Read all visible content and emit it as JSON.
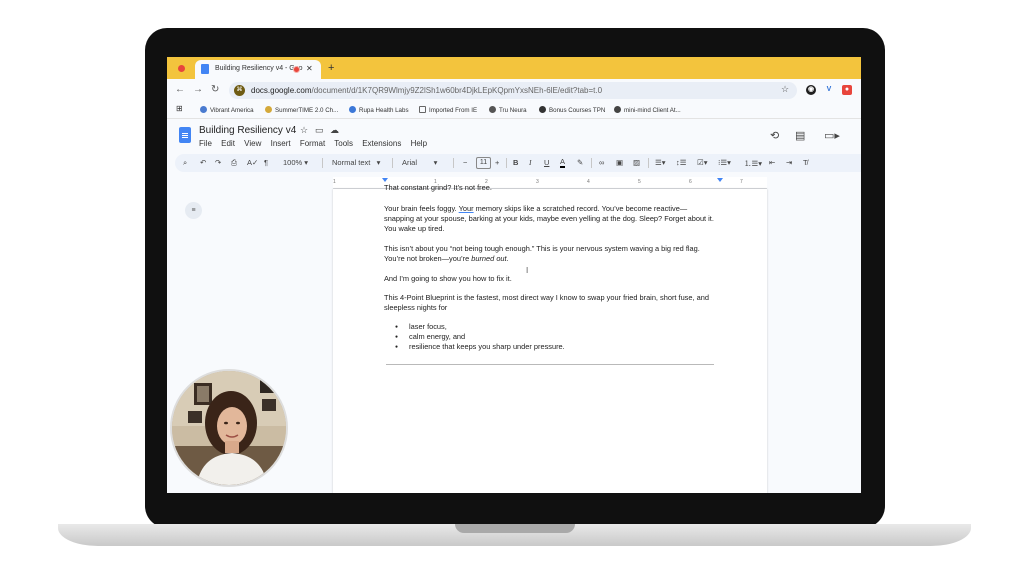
{
  "browser": {
    "tab_title": "Building Resiliency v4 - Goo",
    "tab_close": "✕",
    "new_tab": "+",
    "url_host": "docs.google.com",
    "url_path": "/document/d/1K7QR9Wlmjy9Z2lSh1w60br4DjkLEpKQpmYxsNEh-6lE/edit?tab=t.0",
    "extensions": [
      "V"
    ],
    "bookmarks": [
      {
        "label": "Vibrant America",
        "color": "#4a7bd0"
      },
      {
        "label": "SummerTIME 2.0 Ch...",
        "color": "#d4a93a"
      },
      {
        "label": "Rupa Health Labs",
        "color": "#3c78d8"
      },
      {
        "label": "Imported From IE",
        "color": "#888888"
      },
      {
        "label": "Tru Neura",
        "color": "#555555"
      },
      {
        "label": "Bonus Courses TPN",
        "color": "#333333"
      },
      {
        "label": "mini-mind Client At...",
        "color": "#444444"
      }
    ]
  },
  "docs": {
    "title": "Building Resiliency v4",
    "menu": [
      "File",
      "Edit",
      "View",
      "Insert",
      "Format",
      "Tools",
      "Extensions",
      "Help"
    ],
    "toolbar": {
      "zoom": "100%",
      "style": "Normal text",
      "font": "Arial",
      "font_size": "11",
      "minus": "−",
      "plus": "+"
    },
    "ruler_numbers": [
      "1",
      "1",
      "2",
      "3",
      "4",
      "5",
      "6",
      "7"
    ]
  },
  "document": {
    "p0": "That constant grind? It’s not free.",
    "p1_a": "Your brain feels foggy. ",
    "p1_u": "Your",
    "p1_b": " memory skips like a scratched record. You’ve become reactive—snapping at your spouse, barking at your kids, maybe even yelling at the dog. Sleep? Forget about it. You wake up tired.",
    "p2_a": "This isn’t about you “not being tough enough.” This is your nervous system waving a big red flag. You’re not broken—you’re ",
    "p2_i": "burned out",
    "p2_b": ".",
    "p3": "And I’m going to show you how to fix it.",
    "p4": "This 4-Point Blueprint is the fastest, most direct way I know to swap your fried brain, short fuse, and sleepless nights for",
    "bullets": [
      "laser focus,",
      "calm energy, and",
      "resilience that keeps you sharp under pressure."
    ]
  },
  "colors": {
    "tabbar": "#f3c43d",
    "docs_blue": "#4285f4",
    "record_red": "#e8453c"
  }
}
